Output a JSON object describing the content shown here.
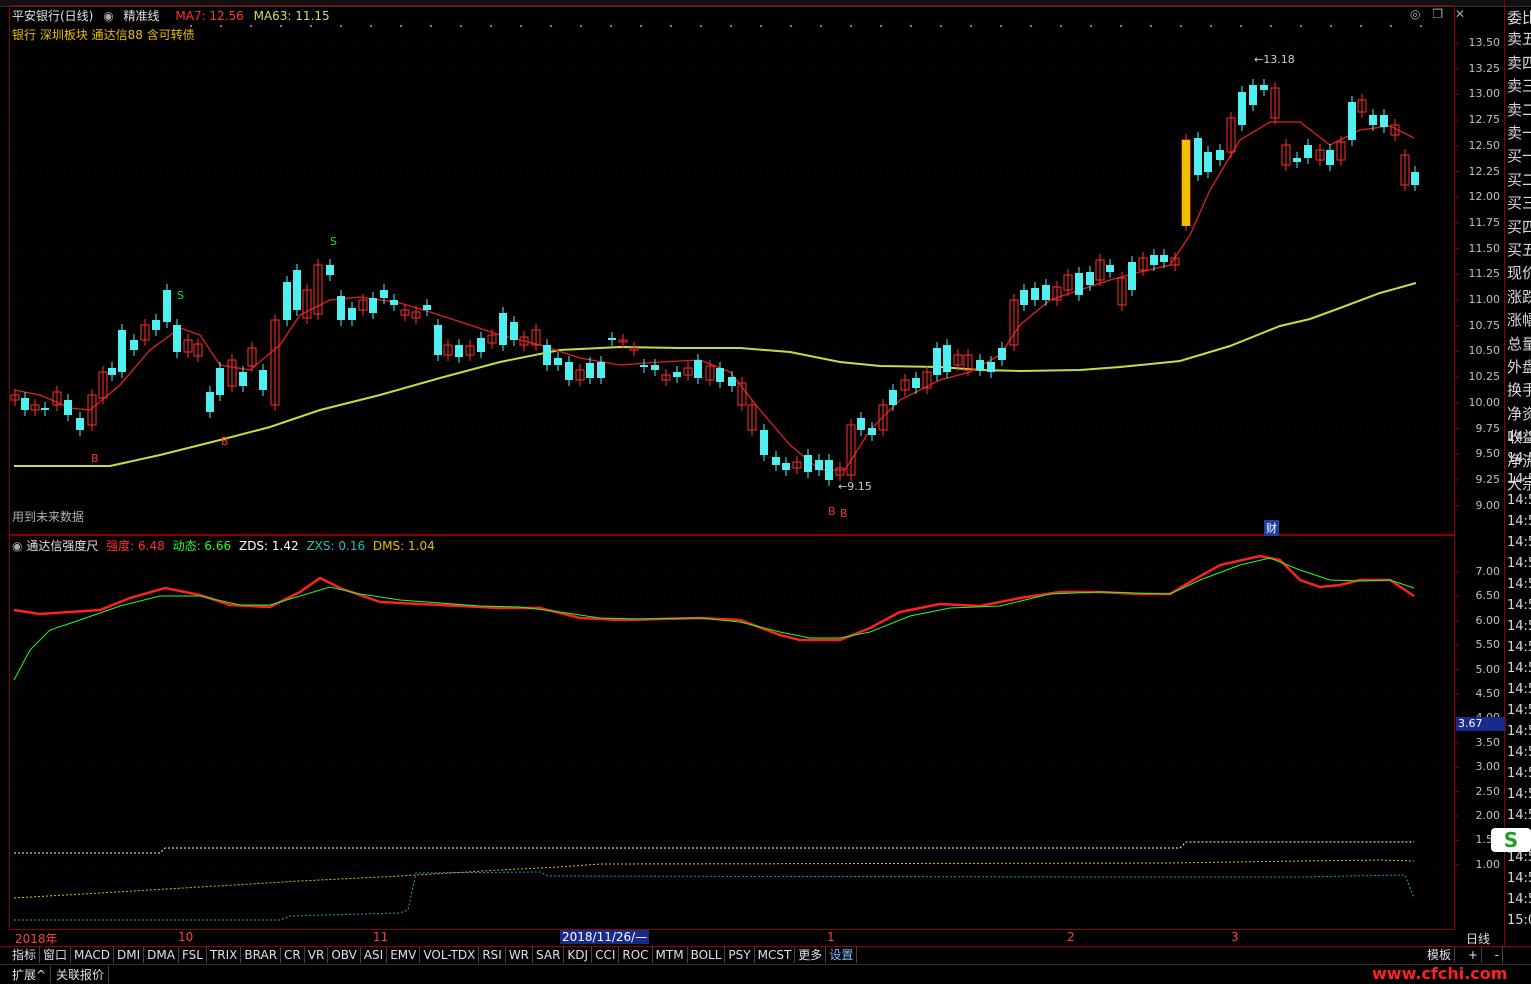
{
  "header": {
    "stock_name": "平安银行(日线)",
    "indicator_name": "精准线",
    "ma7": "MA7: 12.56",
    "ma63": "MA63: 11.15",
    "tags": "银行 深圳板块 通达信88 含可转债",
    "window_buttons": [
      "◎",
      "❐",
      "✕"
    ]
  },
  "main_chart": {
    "y_ticks": [
      "13.50",
      "13.25",
      "13.00",
      "12.75",
      "12.50",
      "12.25",
      "12.00",
      "11.75",
      "11.50",
      "11.25",
      "11.00",
      "10.75",
      "10.50",
      "10.25",
      "10.00",
      "9.75",
      "9.50",
      "9.25",
      "9.00"
    ],
    "future_data_note": "用到未来数据",
    "high_label": "13.18",
    "low_label": "9.15",
    "signal_s": "S",
    "signal_b": "B",
    "cai_badge": "财"
  },
  "sub_chart": {
    "title": "通达信强度尺",
    "strength": "强度: 6.48",
    "dynamic": "动态: 6.66",
    "zds": "ZDS: 1.42",
    "zxs": "ZXS: 0.16",
    "dms": "DMS: 1.04",
    "y_ticks": [
      "7.00",
      "6.50",
      "6.00",
      "5.50",
      "5.00",
      "4.50",
      "4.00",
      "3.50",
      "3.00",
      "2.50",
      "2.00",
      "1.50",
      "1.00"
    ],
    "cursor_value": "3.67",
    "colors": {
      "strength": "#ff2020",
      "dynamic": "#20ff20",
      "zds": "#ffffff",
      "zxs": "#20c0c0",
      "dms": "#e0c000"
    }
  },
  "x_axis": {
    "labels": [
      "2018年",
      "10",
      "11",
      "2018/11/26/—",
      "1",
      "2",
      "3"
    ],
    "period": "日线"
  },
  "right_panel": {
    "items": [
      "委比",
      "卖五",
      "卖四",
      "卖三",
      "卖二",
      "卖一",
      "买一",
      "买二",
      "买三",
      "买四",
      "买五",
      "现价",
      "涨跌",
      "涨幅",
      "总量",
      "外盘",
      "换手",
      "净资",
      "收益",
      "净流",
      "大宗"
    ],
    "times": [
      "14:5",
      "14:5",
      "14:5",
      "14:5",
      "14:5",
      "14:5",
      "14:5",
      "14:5",
      "14:5",
      "14:5",
      "14:5",
      "14:5",
      "14:5",
      "14:5",
      "14:5",
      "14:5",
      "14:5",
      "14:5",
      "14:5",
      "14:5",
      "14:5",
      "14:5",
      "14:5",
      "15:0"
    ]
  },
  "tabs": [
    "指标",
    "窗口",
    "MACD",
    "DMI",
    "DMA",
    "FSL",
    "TRIX",
    "BRAR",
    "CR",
    "VR",
    "OBV",
    "ASI",
    "EMV",
    "VOL-TDX",
    "RSI",
    "WR",
    "SAR",
    "KDJ",
    "CCI",
    "ROC",
    "MTM",
    "BOLL",
    "PSY",
    "MCST",
    "更多",
    "设置"
  ],
  "right_tabs": [
    "模板",
    "+",
    "-"
  ],
  "extension": {
    "expand": "扩展^",
    "related": "关联报价"
  },
  "watermark": "www.cfchi.com",
  "logo_text": "S"
}
